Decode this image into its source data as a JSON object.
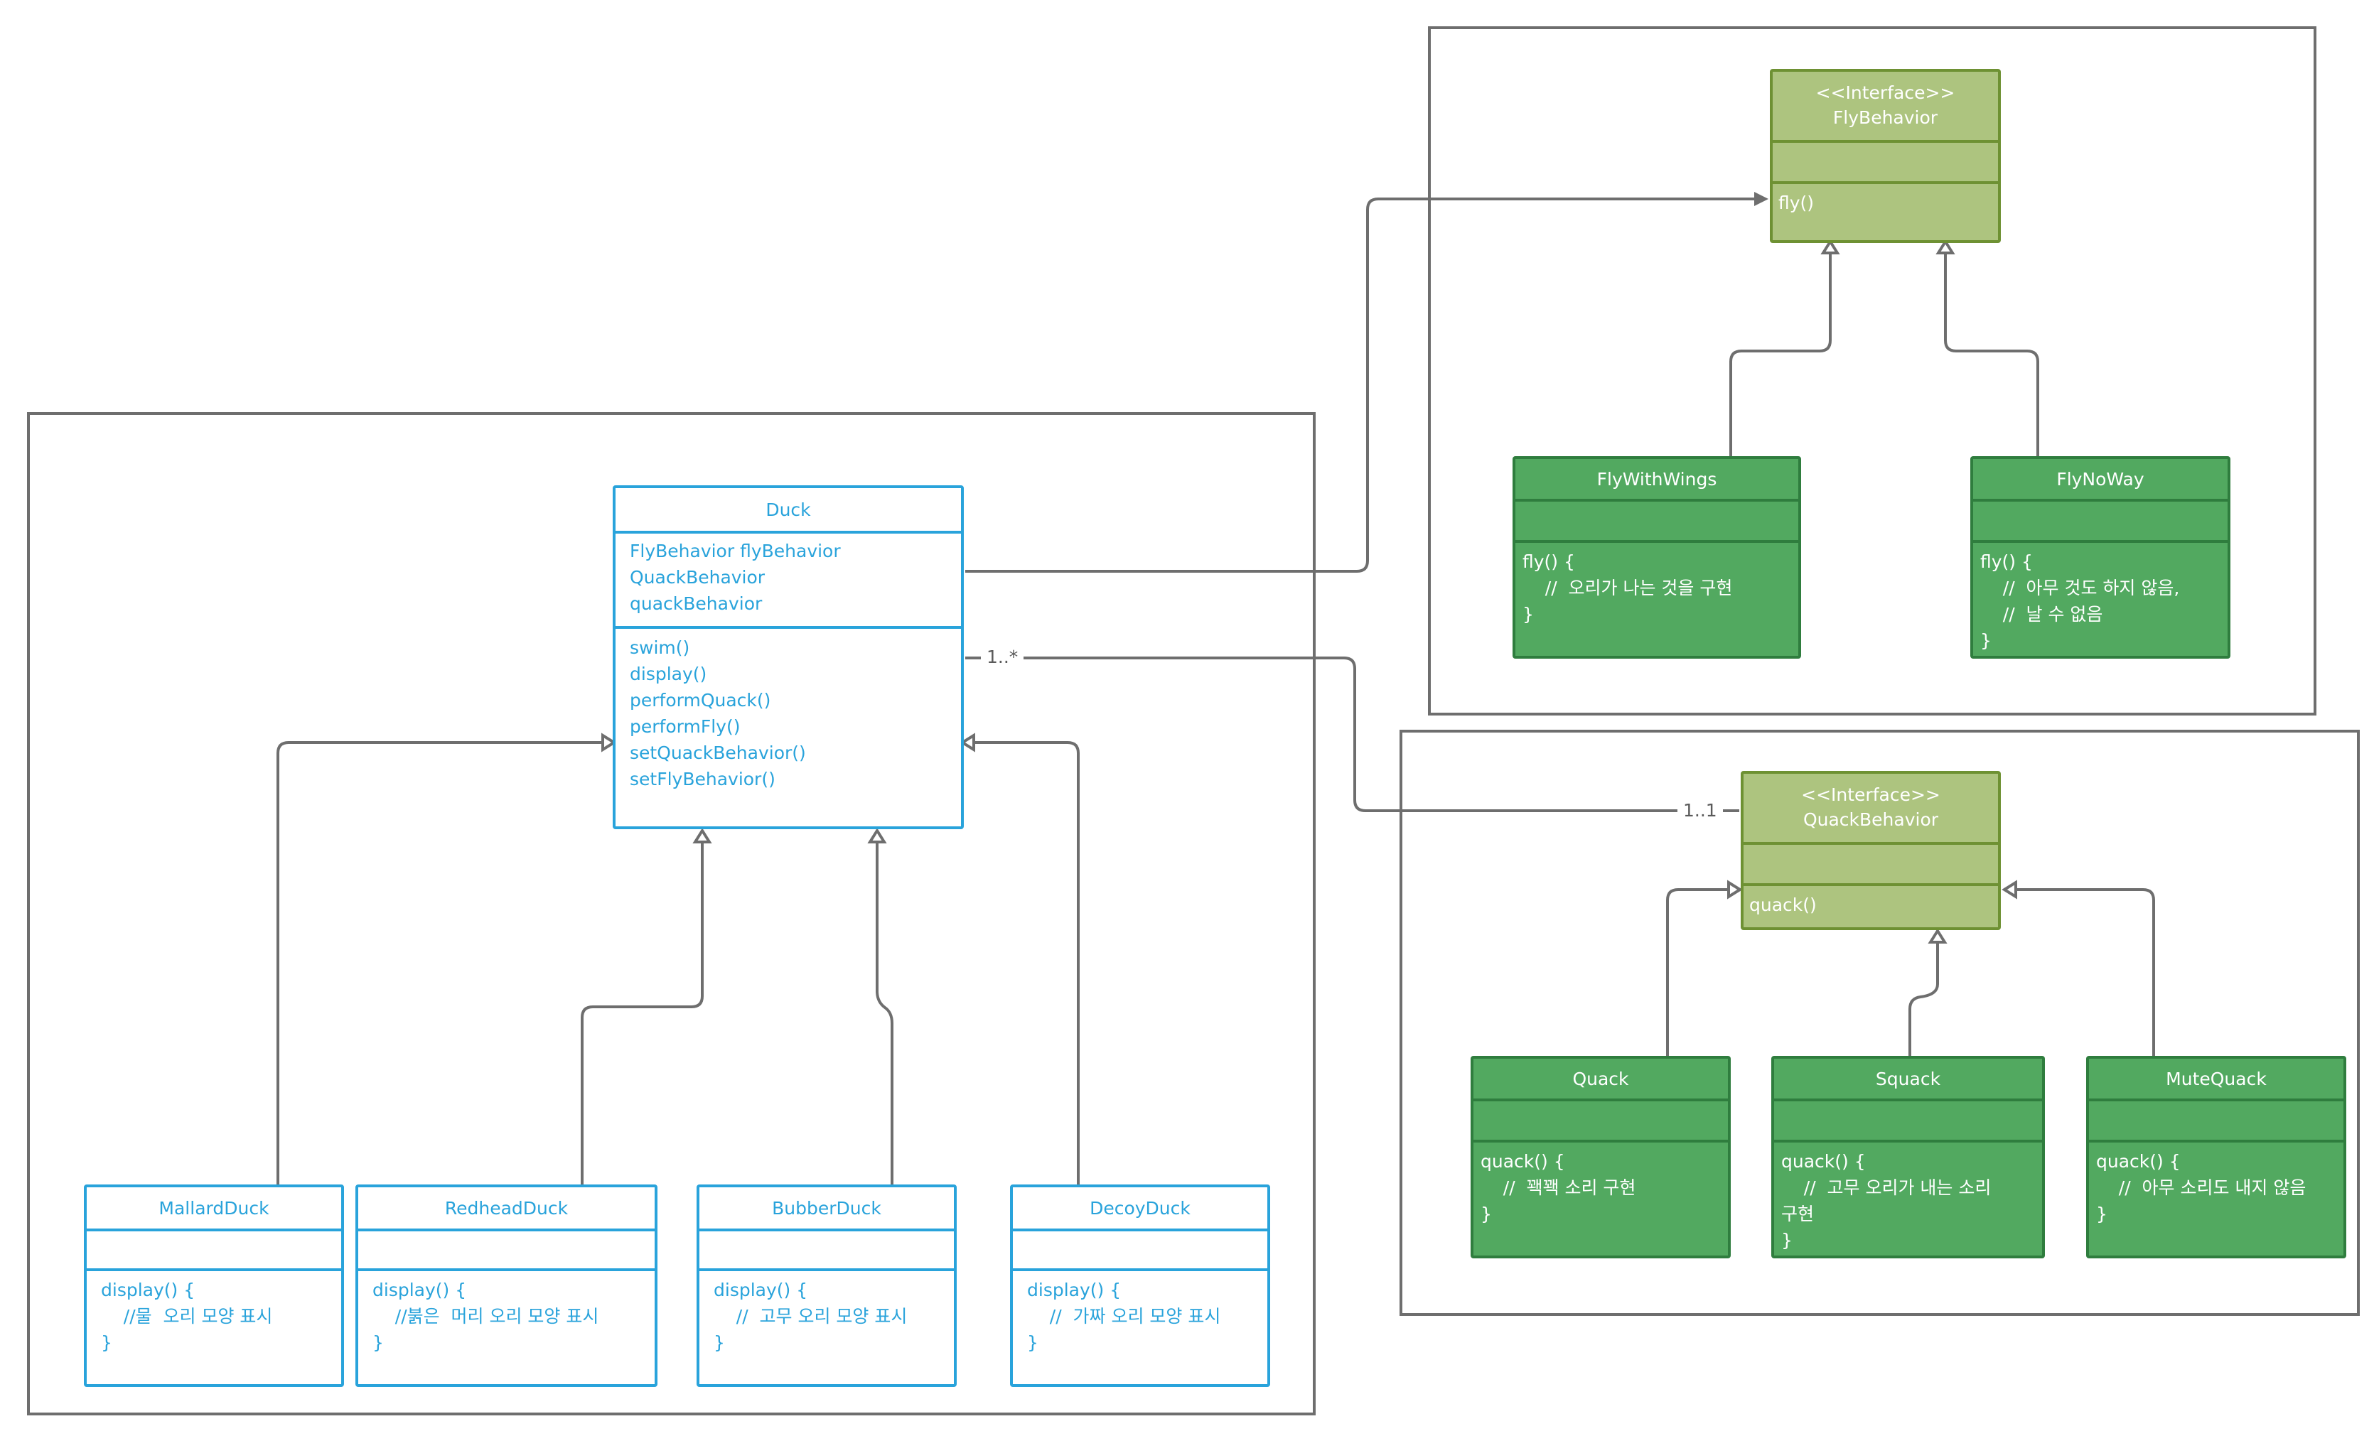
{
  "classes": {
    "duck": {
      "name": "Duck",
      "attributes": [
        "FlyBehavior flyBehavior",
        "QuackBehavior",
        "quackBehavior"
      ],
      "methods": [
        "swim()",
        "display()",
        "performQuack()",
        "performFly()",
        "setQuackBehavior()",
        "setFlyBehavior()"
      ]
    },
    "mallard_duck": {
      "name": "MallardDuck",
      "methods": [
        "display() {",
        "    //물  오리 모양 표시",
        "}"
      ]
    },
    "redhead_duck": {
      "name": "RedheadDuck",
      "methods": [
        "display() {",
        "    //붉은  머리 오리 모양 표시",
        "}"
      ]
    },
    "bubber_duck": {
      "name": "BubberDuck",
      "methods": [
        "display() {",
        "    //  고무 오리 모양 표시",
        "}"
      ]
    },
    "decoy_duck": {
      "name": "DecoyDuck",
      "methods": [
        "display() {",
        "    //  가짜 오리 모양 표시",
        "}"
      ]
    },
    "fly_behavior": {
      "stereotype": "<<Interface>>",
      "name": "FlyBehavior",
      "methods": [
        "fly()"
      ]
    },
    "fly_with_wings": {
      "name": "FlyWithWings",
      "methods": [
        "fly() {",
        "    //  오리가 나는 것을 구현",
        "}"
      ]
    },
    "fly_no_way": {
      "name": "FlyNoWay",
      "methods": [
        "fly() {",
        "    //  아무 것도 하지 않음,",
        "    //  날 수 없음",
        "}"
      ]
    },
    "quack_behavior": {
      "stereotype": "<<Interface>>",
      "name": "QuackBehavior",
      "methods": [
        "quack()"
      ]
    },
    "quack": {
      "name": "Quack",
      "methods": [
        "quack() {",
        "    //  꽥꽥 소리 구현",
        "}"
      ]
    },
    "squack": {
      "name": "Squack",
      "methods": [
        "quack() {",
        "    //  고무 오리가 내는 소리",
        "구현",
        "}"
      ]
    },
    "mute_quack": {
      "name": "MuteQuack",
      "methods": [
        "quack() {",
        "    //  아무 소리도 내지 않음",
        "}"
      ]
    }
  },
  "multiplicities": {
    "duck_end": "1..*",
    "quack_behavior_end": "1..1"
  },
  "relationships": [
    {
      "kind": "inheritance",
      "from": "MallardDuck",
      "to": "Duck"
    },
    {
      "kind": "inheritance",
      "from": "RedheadDuck",
      "to": "Duck"
    },
    {
      "kind": "inheritance",
      "from": "BubberDuck",
      "to": "Duck"
    },
    {
      "kind": "inheritance",
      "from": "DecoyDuck",
      "to": "Duck"
    },
    {
      "kind": "association",
      "from": "Duck",
      "to": "FlyBehavior"
    },
    {
      "kind": "association",
      "from": "Duck",
      "to": "QuackBehavior"
    },
    {
      "kind": "realization",
      "from": "FlyWithWings",
      "to": "FlyBehavior"
    },
    {
      "kind": "realization",
      "from": "FlyNoWay",
      "to": "FlyBehavior"
    },
    {
      "kind": "realization",
      "from": "Quack",
      "to": "QuackBehavior"
    },
    {
      "kind": "realization",
      "from": "Squack",
      "to": "QuackBehavior"
    },
    {
      "kind": "realization",
      "from": "MuteQuack",
      "to": "QuackBehavior"
    }
  ],
  "colors": {
    "concrete_class": "#29a3db",
    "interface_fill": "#adc47f",
    "implementation_fill": "#52a960",
    "connector": "#6e6e6e"
  }
}
